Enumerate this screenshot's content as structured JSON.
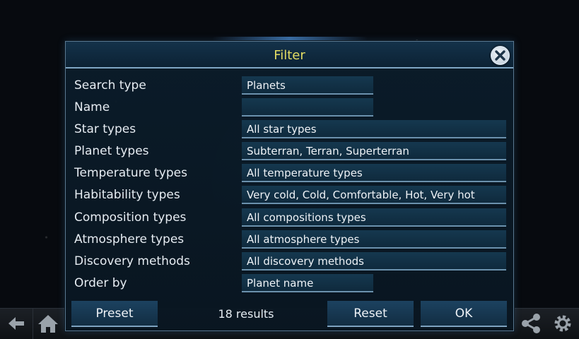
{
  "dialog": {
    "title": "Filter",
    "close_icon": "close-icon"
  },
  "rows": [
    {
      "label": "Search type",
      "value": "Planets"
    },
    {
      "label": "Name",
      "value": ""
    },
    {
      "label": "Star types",
      "value": "All star types"
    },
    {
      "label": "Planet types",
      "value": "Subterran, Terran, Superterran"
    },
    {
      "label": "Temperature types",
      "value": "All temperature types"
    },
    {
      "label": "Habitability types",
      "value": "Very cold, Cold, Comfortable, Hot, Very hot"
    },
    {
      "label": "Composition types",
      "value": "All compositions types"
    },
    {
      "label": "Atmosphere types",
      "value": "All atmosphere types"
    },
    {
      "label": "Discovery methods",
      "value": "All discovery methods"
    },
    {
      "label": "Order by",
      "value": "Planet name"
    }
  ],
  "footer": {
    "preset_label": "Preset",
    "results_text": "18 results",
    "reset_label": "Reset",
    "ok_label": "OK"
  },
  "toolbar": {
    "icons": [
      "back-arrow-icon",
      "home-icon",
      "info-icon",
      "list-icon",
      "share-icon",
      "gear-icon"
    ]
  },
  "colors": {
    "title": "#e3dc63",
    "dialog_bg": "#0b1c2a",
    "field_bg": "#15384f",
    "field_underline": "#6b91ad"
  }
}
